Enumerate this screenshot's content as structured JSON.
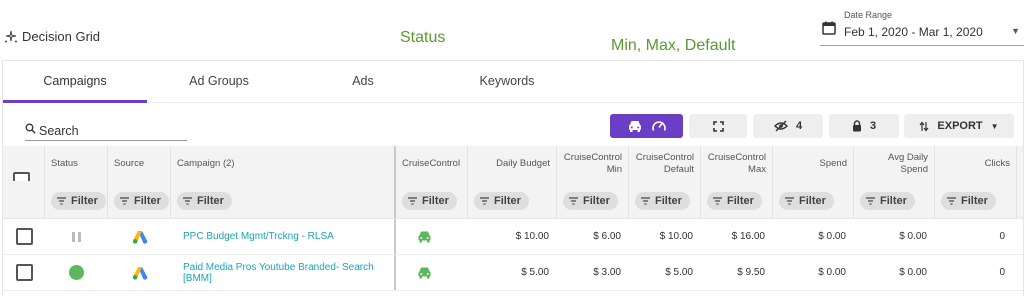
{
  "app": {
    "title": "Decision Grid"
  },
  "date_range": {
    "label": "Date Range",
    "value": "Feb 1, 2020 - Mar 1, 2020"
  },
  "annotations": {
    "status": "Status",
    "minmax": "Min, Max, Default",
    "color": "#5a9a2f"
  },
  "tabs": [
    {
      "label": "Campaigns",
      "active": true
    },
    {
      "label": "Ad Groups",
      "active": false
    },
    {
      "label": "Ads",
      "active": false
    },
    {
      "label": "Keywords",
      "active": false
    }
  ],
  "search": {
    "placeholder": "Search"
  },
  "toolbar": {
    "hidden_count": "4",
    "locked_count": "3",
    "export_label": "EXPORT"
  },
  "grid": {
    "columns": [
      "Status",
      "Source",
      "Campaign (2)",
      "CruiseControl",
      "Daily Budget",
      "CruiseControl Min",
      "CruiseControl Default",
      "CruiseControl Max",
      "Spend",
      "Avg Daily Spend",
      "Clicks"
    ],
    "filter_label": "Filter",
    "rows": [
      {
        "status": "paused",
        "campaign": "PPC Budget Mgmt/Trckng - RLSA",
        "daily_budget": "$ 10.00",
        "cc_min": "$ 6.00",
        "cc_default": "$ 10.00",
        "cc_max": "$ 16.00",
        "spend": "$ 0.00",
        "avg_daily_spend": "$ 0.00",
        "clicks": "0"
      },
      {
        "status": "active",
        "campaign": "Paid Media Pros Youtube Branded- Search [BMM]",
        "daily_budget": "$ 5.00",
        "cc_min": "$ 3.00",
        "cc_default": "$ 5.00",
        "cc_max": "$ 9.50",
        "spend": "$ 0.00",
        "avg_daily_spend": "$ 0.00",
        "clicks": "0"
      }
    ]
  },
  "colors": {
    "accent": "#6a3fc6",
    "link": "#1aa3b8",
    "active_status": "#5cb85c",
    "cruise_icon": "#5cb85c"
  }
}
